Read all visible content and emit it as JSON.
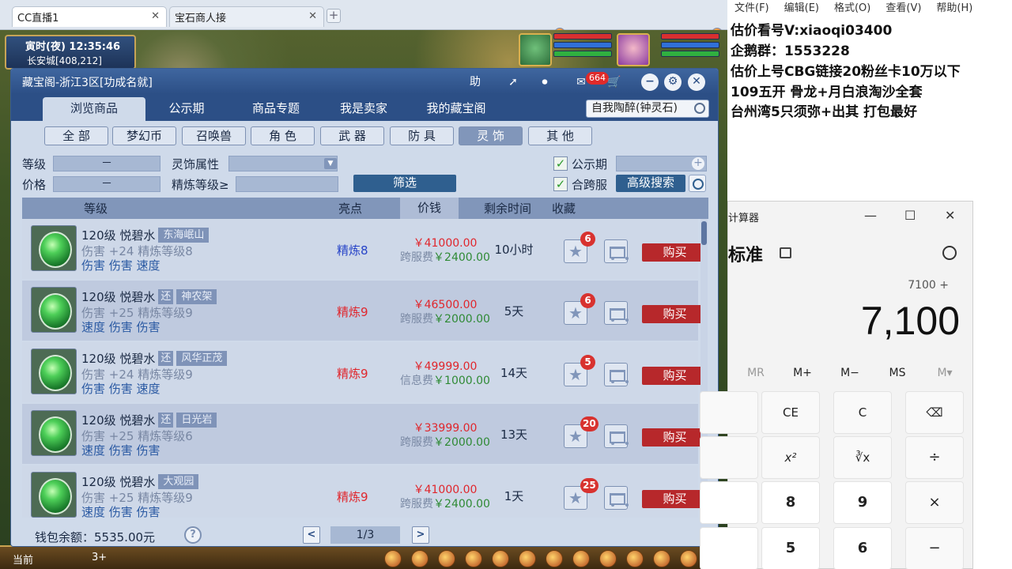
{
  "browser": {
    "tabs": [
      {
        "label": "CC直播1",
        "active": true
      },
      {
        "label": "宝石商人接",
        "active": false
      }
    ],
    "new_tab": "+"
  },
  "game": {
    "time": "寅时(夜)   12:35:46",
    "location": "长安城[408,212]",
    "bottom": {
      "label1": "当前",
      "label2": "3+"
    }
  },
  "cbg": {
    "title": "藏宝阁-浙江3区[功成名就]",
    "title_buttons": {
      "help": "助",
      "badge": "664"
    },
    "nav_tabs": [
      "浏览商品",
      "公示期",
      "商品专题",
      "我是卖家",
      "我的藏宝阁"
    ],
    "search_value": "自我陶醉(钟灵石)",
    "categories": [
      "全  部",
      "梦幻币",
      "召唤兽",
      "角  色",
      "武  器",
      "防  具",
      "灵  饰",
      "其  他"
    ],
    "active_category": 6,
    "filters": {
      "level_label": "等级",
      "level_value": "－",
      "price_label": "价格",
      "price_value": "－",
      "attr_label": "灵饰属性",
      "attr_value": "",
      "refine_label": "精炼等级≥",
      "refine_value": "",
      "filter_button": "筛选",
      "public_label": "公示期",
      "public_checked": true,
      "cross_label": "合跨服",
      "cross_checked": true,
      "advanced_button": "高级搜索"
    },
    "columns": [
      "等级",
      "亮点",
      "价钱",
      "剩余时间",
      "收藏"
    ],
    "rows": [
      {
        "title": "120级  悦碧水",
        "huan": "",
        "server": "东海岷山",
        "attr": "伤害 +24 精炼等级8",
        "sub": "伤害 伤害 速度",
        "highlight": "精炼8",
        "highlight_color": "#2744c8",
        "price": "￥41000.00",
        "fee_label": "跨服费",
        "fee": "￥2400.00",
        "remain": "10小时",
        "fav": "6",
        "buy": "购买"
      },
      {
        "title": "120级  悦碧水",
        "huan": "还",
        "server": "神农架",
        "attr": "伤害 +25 精炼等级9",
        "sub": "速度 伤害 伤害",
        "highlight": "精炼9",
        "highlight_color": "#e0262c",
        "price": "￥46500.00",
        "fee_label": "跨服费",
        "fee": "￥2000.00",
        "remain": "5天",
        "fav": "6",
        "buy": "购买"
      },
      {
        "title": "120级  悦碧水",
        "huan": "还",
        "server": "风华正茂",
        "attr": "伤害 +24 精炼等级9",
        "sub": "伤害 伤害 速度",
        "highlight": "精炼9",
        "highlight_color": "#e0262c",
        "price": "￥49999.00",
        "fee_label": "信息费",
        "fee": "￥1000.00",
        "remain": "14天",
        "fav": "5",
        "buy": "购买"
      },
      {
        "title": "120级  悦碧水",
        "huan": "还",
        "server": "日光岩",
        "attr": "伤害 +25 精炼等级6",
        "sub": "速度 伤害 伤害",
        "highlight": "",
        "highlight_color": "#e0262c",
        "price": "￥33999.00",
        "fee_label": "跨服费",
        "fee": "￥2000.00",
        "remain": "13天",
        "fav": "20",
        "buy": "购买"
      },
      {
        "title": "120级  悦碧水",
        "huan": "",
        "server": "大观园",
        "attr": "伤害 +25 精炼等级9",
        "sub": "速度 伤害 伤害",
        "highlight": "精炼9",
        "highlight_color": "#e0262c",
        "price": "￥41000.00",
        "fee_label": "跨服费",
        "fee": "￥2400.00",
        "remain": "1天",
        "fav": "25",
        "buy": "购买"
      }
    ],
    "footer": {
      "wallet": "钱包余额：5535.00元",
      "help": "?",
      "prev": "<",
      "page": "1/3",
      "next": ">"
    }
  },
  "notepad": {
    "menu": [
      "文件(F)",
      "编辑(E)",
      "格式(O)",
      "查看(V)",
      "帮助(H)"
    ],
    "lines": [
      "估价看号V:xiaoqi03400",
      "企鹅群：1553228",
      "估价上号CBG链接20粉丝卡10万以下",
      "109五开 骨龙+月白浪淘沙全套",
      "台州湾5只须弥+出其 打包最好"
    ]
  },
  "calculator": {
    "title": "计算器",
    "window": {
      "min": "—",
      "max": "☐",
      "close": "✕"
    },
    "mode": "标准",
    "expression": "7100 +",
    "display": "7,100",
    "memory": [
      "MR",
      "M+",
      "M−",
      "MS",
      "M▾"
    ],
    "keys": [
      "CE",
      "C",
      "⌫",
      "x²",
      "∛x",
      "÷",
      "8",
      "9",
      "×",
      "5",
      "6",
      "−"
    ]
  }
}
